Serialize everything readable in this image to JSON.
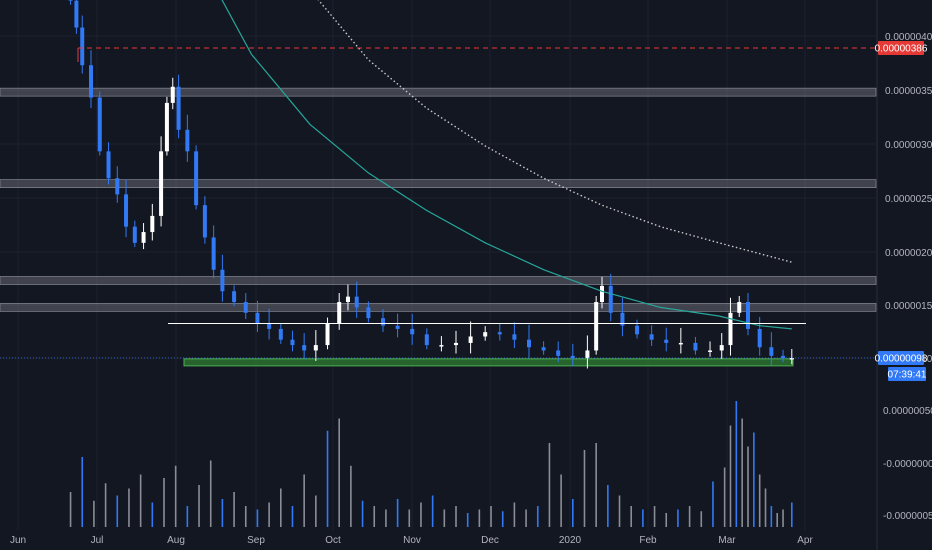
{
  "colors": {
    "background": "#131722",
    "grid": "#1e222d",
    "candle_up": "#ffffff",
    "candle_down": "#3179f5",
    "ma_fast": "#26a69a",
    "ma_slow": "#c9c9c9",
    "resistance": "#e53935",
    "support_zone": "#2e7d32",
    "zone_band": "#787b86",
    "axis_text": "#b2b5be",
    "price_badge": "#3179f5",
    "resistance_badge": "#e53935"
  },
  "chart_data": {
    "type": "candlestick",
    "x_ticks": [
      "Jun",
      "Jul",
      "Aug",
      "Sep",
      "Oct",
      "Nov",
      "Dec",
      "2020",
      "Feb",
      "Mar",
      "Apr"
    ],
    "y_ticks": [
      "0.00000400",
      "0.00000350",
      "0.00000300",
      "0.00000250",
      "0.00000200",
      "0.00000150",
      "0.00000100"
    ],
    "ylim": [
      8e-07,
      4.2e-06
    ],
    "grid": true,
    "close_series": [
      {
        "day": 18,
        "close": 4.3e-06
      },
      {
        "day": 20,
        "close": 4.05e-06
      },
      {
        "day": 22,
        "close": 3.7e-06
      },
      {
        "day": 25,
        "close": 3.4e-06
      },
      {
        "day": 28,
        "close": 2.9e-06
      },
      {
        "day": 31,
        "close": 2.65e-06
      },
      {
        "day": 34,
        "close": 2.5e-06
      },
      {
        "day": 37,
        "close": 2.2e-06
      },
      {
        "day": 40,
        "close": 2.05e-06
      },
      {
        "day": 43,
        "close": 2.15e-06
      },
      {
        "day": 46,
        "close": 2.3e-06
      },
      {
        "day": 49,
        "close": 2.9e-06
      },
      {
        "day": 51,
        "close": 3.35e-06
      },
      {
        "day": 53,
        "close": 3.5e-06
      },
      {
        "day": 55,
        "close": 3.1e-06
      },
      {
        "day": 58,
        "close": 2.9e-06
      },
      {
        "day": 61,
        "close": 2.4e-06
      },
      {
        "day": 64,
        "close": 2.1e-06
      },
      {
        "day": 67,
        "close": 1.8e-06
      },
      {
        "day": 70,
        "close": 1.6e-06
      },
      {
        "day": 74,
        "close": 1.5e-06
      },
      {
        "day": 78,
        "close": 1.4e-06
      },
      {
        "day": 82,
        "close": 1.3e-06
      },
      {
        "day": 86,
        "close": 1.25e-06
      },
      {
        "day": 90,
        "close": 1.15e-06
      },
      {
        "day": 94,
        "close": 1.1e-06
      },
      {
        "day": 98,
        "close": 1.05e-06
      },
      {
        "day": 102,
        "close": 1.1e-06
      },
      {
        "day": 106,
        "close": 1.3e-06
      },
      {
        "day": 110,
        "close": 1.5e-06
      },
      {
        "day": 113,
        "close": 1.55e-06
      },
      {
        "day": 116,
        "close": 1.45e-06
      },
      {
        "day": 120,
        "close": 1.35e-06
      },
      {
        "day": 125,
        "close": 1.28e-06
      },
      {
        "day": 130,
        "close": 1.25e-06
      },
      {
        "day": 135,
        "close": 1.2e-06
      },
      {
        "day": 140,
        "close": 1.1e-06
      },
      {
        "day": 145,
        "close": 1.1e-06
      },
      {
        "day": 150,
        "close": 1.12e-06
      },
      {
        "day": 155,
        "close": 1.18e-06
      },
      {
        "day": 160,
        "close": 1.22e-06
      },
      {
        "day": 165,
        "close": 1.2e-06
      },
      {
        "day": 170,
        "close": 1.15e-06
      },
      {
        "day": 175,
        "close": 1.08e-06
      },
      {
        "day": 180,
        "close": 1.05e-06
      },
      {
        "day": 185,
        "close": 1e-06
      },
      {
        "day": 190,
        "close": 9.8e-07
      },
      {
        "day": 195,
        "close": 1.05e-06
      },
      {
        "day": 198,
        "close": 1.5e-06
      },
      {
        "day": 200,
        "close": 1.65e-06
      },
      {
        "day": 203,
        "close": 1.4e-06
      },
      {
        "day": 207,
        "close": 1.28e-06
      },
      {
        "day": 212,
        "close": 1.2e-06
      },
      {
        "day": 217,
        "close": 1.15e-06
      },
      {
        "day": 222,
        "close": 1.12e-06
      },
      {
        "day": 227,
        "close": 1.12e-06
      },
      {
        "day": 232,
        "close": 1.05e-06
      },
      {
        "day": 237,
        "close": 1.05e-06
      },
      {
        "day": 241,
        "close": 1.1e-06
      },
      {
        "day": 244,
        "close": 1.4e-06
      },
      {
        "day": 247,
        "close": 1.5e-06
      },
      {
        "day": 250,
        "close": 1.25e-06
      },
      {
        "day": 254,
        "close": 1.08e-06
      },
      {
        "day": 258,
        "close": 1e-06
      },
      {
        "day": 262,
        "close": 9.8e-07
      },
      {
        "day": 265,
        "close": 9.8e-07
      }
    ],
    "volume_series": [
      {
        "day": 18,
        "v": 20
      },
      {
        "day": 22,
        "v": 40
      },
      {
        "day": 26,
        "v": 15
      },
      {
        "day": 30,
        "v": 25
      },
      {
        "day": 34,
        "v": 18
      },
      {
        "day": 38,
        "v": 22
      },
      {
        "day": 42,
        "v": 30
      },
      {
        "day": 46,
        "v": 14
      },
      {
        "day": 50,
        "v": 28
      },
      {
        "day": 54,
        "v": 35
      },
      {
        "day": 58,
        "v": 12
      },
      {
        "day": 62,
        "v": 24
      },
      {
        "day": 66,
        "v": 38
      },
      {
        "day": 70,
        "v": 16
      },
      {
        "day": 74,
        "v": 20
      },
      {
        "day": 78,
        "v": 12
      },
      {
        "day": 82,
        "v": 10
      },
      {
        "day": 86,
        "v": 14
      },
      {
        "day": 90,
        "v": 22
      },
      {
        "day": 94,
        "v": 12
      },
      {
        "day": 98,
        "v": 30
      },
      {
        "day": 102,
        "v": 18
      },
      {
        "day": 106,
        "v": 55
      },
      {
        "day": 110,
        "v": 62
      },
      {
        "day": 114,
        "v": 35
      },
      {
        "day": 118,
        "v": 15
      },
      {
        "day": 122,
        "v": 12
      },
      {
        "day": 126,
        "v": 10
      },
      {
        "day": 130,
        "v": 16
      },
      {
        "day": 134,
        "v": 10
      },
      {
        "day": 138,
        "v": 14
      },
      {
        "day": 142,
        "v": 18
      },
      {
        "day": 146,
        "v": 10
      },
      {
        "day": 150,
        "v": 12
      },
      {
        "day": 154,
        "v": 8
      },
      {
        "day": 158,
        "v": 10
      },
      {
        "day": 162,
        "v": 12
      },
      {
        "day": 166,
        "v": 9
      },
      {
        "day": 170,
        "v": 14
      },
      {
        "day": 174,
        "v": 10
      },
      {
        "day": 178,
        "v": 12
      },
      {
        "day": 182,
        "v": 48
      },
      {
        "day": 186,
        "v": 30
      },
      {
        "day": 190,
        "v": 16
      },
      {
        "day": 194,
        "v": 44
      },
      {
        "day": 198,
        "v": 48
      },
      {
        "day": 202,
        "v": 24
      },
      {
        "day": 206,
        "v": 18
      },
      {
        "day": 210,
        "v": 12
      },
      {
        "day": 214,
        "v": 10
      },
      {
        "day": 218,
        "v": 12
      },
      {
        "day": 222,
        "v": 8
      },
      {
        "day": 226,
        "v": 10
      },
      {
        "day": 230,
        "v": 12
      },
      {
        "day": 234,
        "v": 9
      },
      {
        "day": 238,
        "v": 26
      },
      {
        "day": 242,
        "v": 34
      },
      {
        "day": 244,
        "v": 58
      },
      {
        "day": 246,
        "v": 72
      },
      {
        "day": 248,
        "v": 62
      },
      {
        "day": 250,
        "v": 46
      },
      {
        "day": 252,
        "v": 54
      },
      {
        "day": 254,
        "v": 30
      },
      {
        "day": 256,
        "v": 22
      },
      {
        "day": 258,
        "v": 12
      },
      {
        "day": 260,
        "v": 8
      },
      {
        "day": 262,
        "v": 10
      },
      {
        "day": 265,
        "v": 14
      }
    ],
    "ma_fast": [
      {
        "day": 40,
        "value": 6e-06
      },
      {
        "day": 60,
        "value": 4.8e-06
      },
      {
        "day": 80,
        "value": 3.8e-06
      },
      {
        "day": 100,
        "value": 3.15e-06
      },
      {
        "day": 120,
        "value": 2.7e-06
      },
      {
        "day": 140,
        "value": 2.35e-06
      },
      {
        "day": 160,
        "value": 2.05e-06
      },
      {
        "day": 180,
        "value": 1.8e-06
      },
      {
        "day": 200,
        "value": 1.6e-06
      },
      {
        "day": 220,
        "value": 1.45e-06
      },
      {
        "day": 240,
        "value": 1.37e-06
      },
      {
        "day": 254,
        "value": 1.28e-06
      },
      {
        "day": 265,
        "value": 1.25e-06
      }
    ],
    "ma_slow": [
      {
        "day": 80,
        "value": 5.2e-06
      },
      {
        "day": 100,
        "value": 4.4e-06
      },
      {
        "day": 120,
        "value": 3.75e-06
      },
      {
        "day": 140,
        "value": 3.3e-06
      },
      {
        "day": 160,
        "value": 2.95e-06
      },
      {
        "day": 180,
        "value": 2.65e-06
      },
      {
        "day": 200,
        "value": 2.4e-06
      },
      {
        "day": 220,
        "value": 2.2e-06
      },
      {
        "day": 240,
        "value": 2.05e-06
      },
      {
        "day": 265,
        "value": 1.87e-06
      }
    ],
    "resistance_line": {
      "value": 3.86e-06
    },
    "zone_bands": [
      3.45e-06,
      2.6e-06,
      1.7e-06,
      1.45e-06
    ],
    "range_line": {
      "value": 1.3e-06
    },
    "support_zone": [
      9.3e-07,
      1e-06
    ],
    "current_price": 9.8e-07,
    "price_label": "0.00000098",
    "resistance_label": "0.00000386",
    "countdown_label": "07:39:41",
    "volume_ticks": [
      "0.00000050",
      "-0.00000000",
      "-0.00000050"
    ]
  }
}
